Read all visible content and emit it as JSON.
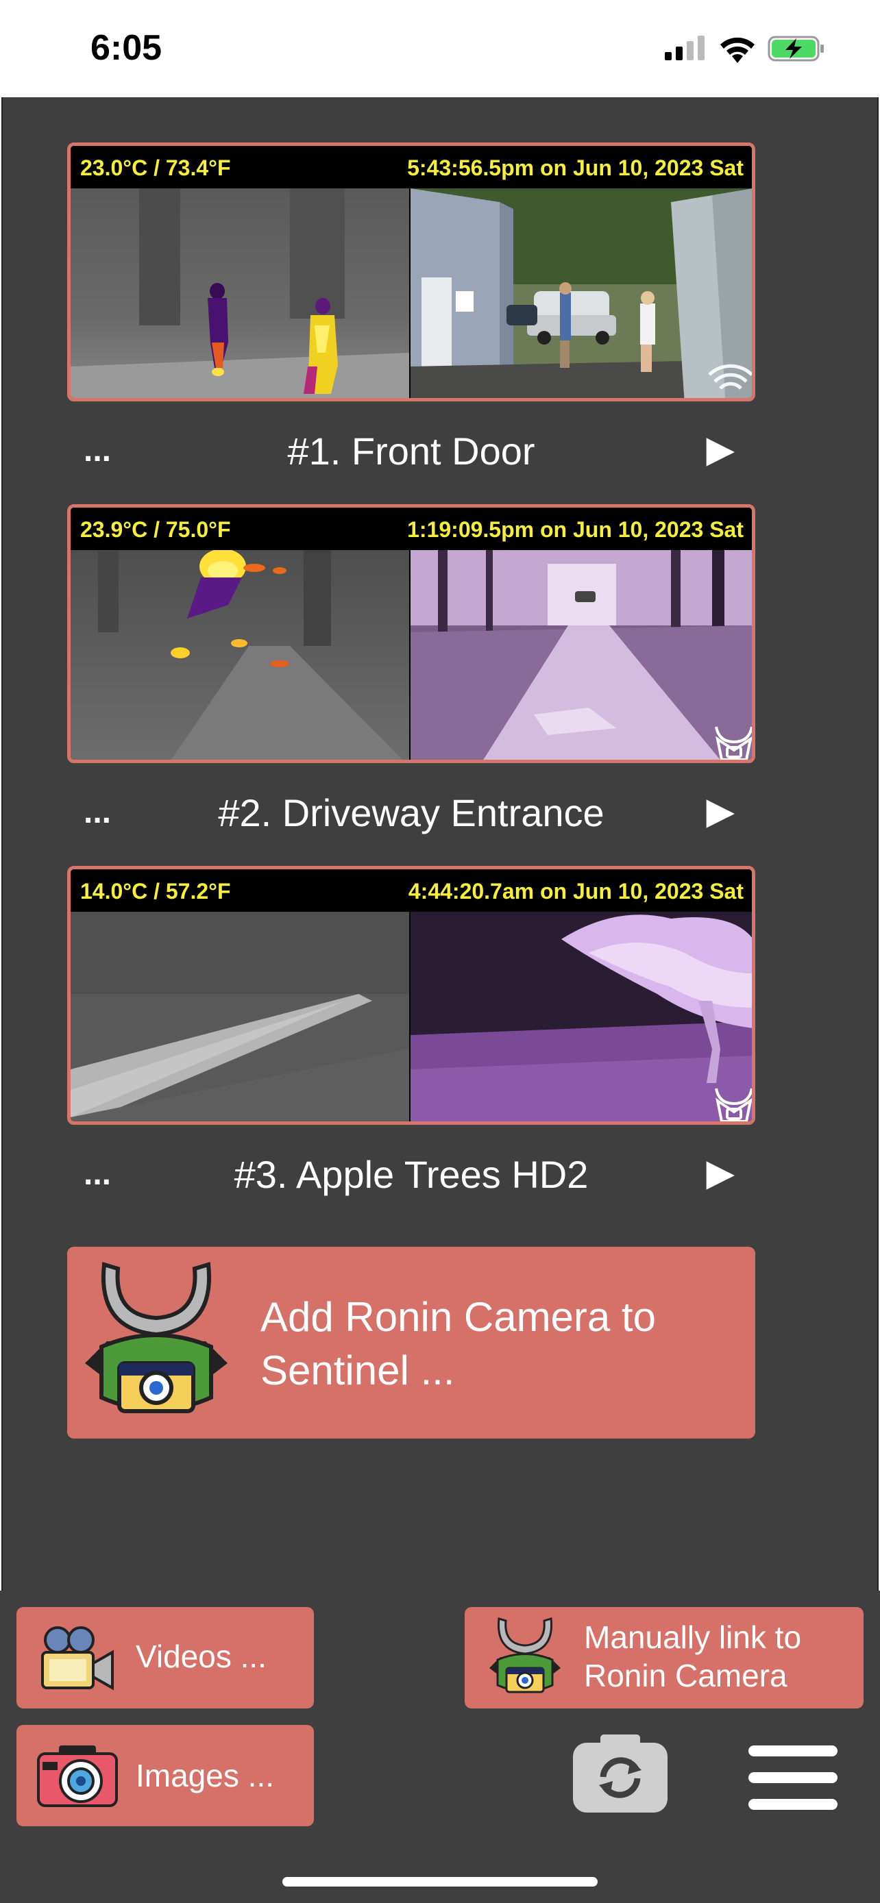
{
  "status_bar": {
    "time": "6:05"
  },
  "cameras": [
    {
      "temp": "23.0°C / 73.4°F",
      "timestamp": "5:43:56.5pm on Jun 10, 2023 Sat",
      "menu": "...",
      "name": "#1. Front Door",
      "play": "▶"
    },
    {
      "temp": "23.9°C / 75.0°F",
      "timestamp": "1:19:09.5pm on Jun 10, 2023 Sat",
      "menu": "...",
      "name": "#2. Driveway Entrance",
      "play": "▶"
    },
    {
      "temp": "14.0°C / 57.2°F",
      "timestamp": "4:44:20.7am on Jun 10, 2023 Sat",
      "menu": "...",
      "name": "#3. Apple Trees HD2",
      "play": "▶"
    }
  ],
  "add_camera": {
    "line1": "Add Ronin Camera to",
    "line2": "Sentinel ..."
  },
  "toolbar": {
    "videos_label": "Videos ...",
    "images_label": "Images ...",
    "link_line1": "Manually link to",
    "link_line2": "Ronin Camera"
  },
  "icons": [
    "signal-icon",
    "wifi-icon",
    "battery-charging-icon",
    "wifi-badge-icon",
    "ronin-badge-icon",
    "ronin-camera-icon",
    "film-camera-icon",
    "photo-camera-icon",
    "refresh-camera-icon",
    "hamburger-menu-icon"
  ],
  "colors": {
    "accent": "#d6716a",
    "background": "#3f3f3f",
    "overlay_text": "#f6ef3a",
    "battery": "#4cd964"
  }
}
